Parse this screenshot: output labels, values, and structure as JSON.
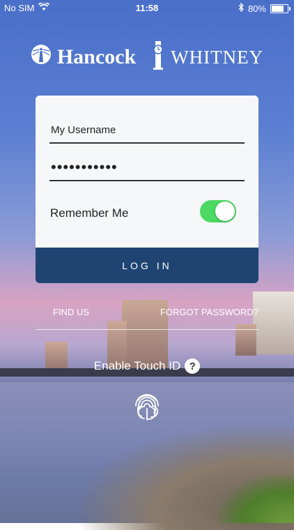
{
  "status_bar": {
    "carrier": "No SIM",
    "time": "11:58",
    "battery_percent": "80%",
    "battery_level": 0.8,
    "icons": [
      "wifi-icon",
      "bluetooth-icon",
      "battery-icon"
    ]
  },
  "branding": {
    "brand_left": "Hancock",
    "brand_right": "Whitney",
    "icons": [
      "lighthouse-logo-icon",
      "clock-tower-logo-icon"
    ]
  },
  "login_form": {
    "username_value": "My Username",
    "password_value": "•••••••••••",
    "remember_label": "Remember Me",
    "remember_on": true,
    "login_label": "LOG IN"
  },
  "links": {
    "find_us": "FIND US",
    "forgot_password": "FORGOT PASSWORD?"
  },
  "touch_id": {
    "label": "Enable Touch ID",
    "help_symbol": "?",
    "icon": "fingerprint-icon"
  },
  "colors": {
    "primary": "#1f4472",
    "toggle_on": "#4cd964",
    "card_bg": "#f6f7f9"
  }
}
